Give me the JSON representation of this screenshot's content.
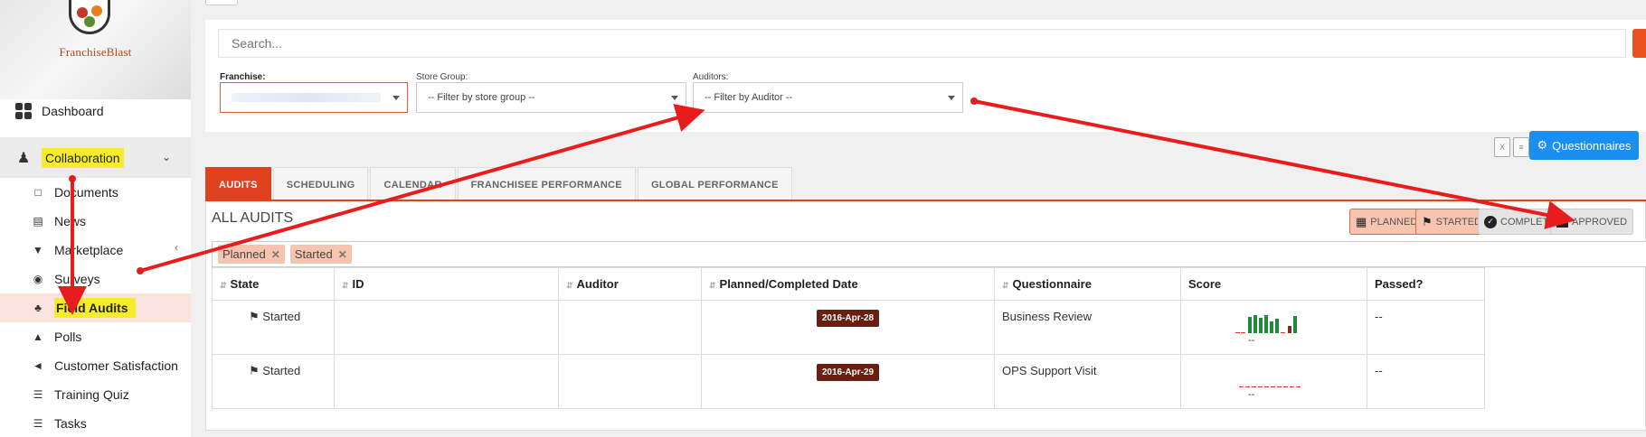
{
  "sidebar": {
    "logo_text": "FranchiseBlast",
    "dashboard_label": "Dashboard",
    "collaboration_label": "Collaboration",
    "items": [
      {
        "label": "Documents",
        "icon": "document-icon"
      },
      {
        "label": "News",
        "icon": "newspaper-icon"
      },
      {
        "label": "Marketplace",
        "icon": "cart-icon"
      },
      {
        "label": "Surveys",
        "icon": "target-icon"
      },
      {
        "label": "Field Audits",
        "icon": "trophy-icon"
      },
      {
        "label": "Polls",
        "icon": "bell-icon"
      },
      {
        "label": "Customer Satisfaction",
        "icon": "bullhorn-icon"
      },
      {
        "label": "Training Quiz",
        "icon": "list-icon"
      },
      {
        "label": "Tasks",
        "icon": "tasks-icon"
      }
    ]
  },
  "search": {
    "placeholder": "Search..."
  },
  "filters": {
    "franchise_label": "Franchise:",
    "store_group_label": "Store Group:",
    "store_group_value": "-- Filter by store group --",
    "auditors_label": "Auditors:",
    "auditors_value": "-- Filter by Auditor --"
  },
  "questionnaires_label": "Questionnaires",
  "tabs": [
    "AUDITS",
    "SCHEDULING",
    "CALENDAR",
    "FRANCHISEE PERFORMANCE",
    "GLOBAL PERFORMANCE"
  ],
  "panel_title": "ALL AUDITS",
  "status_filters": {
    "planned": "PLANNED",
    "started": "STARTED",
    "completed": "COMPLETED",
    "approved": "APPROVED"
  },
  "active_tags": [
    "Planned",
    "Started"
  ],
  "table": {
    "headers": [
      "State",
      "ID",
      "Auditor",
      "Planned/Completed Date",
      "Questionnaire",
      "Score",
      "Passed?"
    ],
    "rows": [
      {
        "state": "Started",
        "date": "2016-Apr-28",
        "questionnaire": "Business Review",
        "score": "--",
        "passed": "--"
      },
      {
        "state": "Started",
        "date": "2016-Apr-29",
        "questionnaire": "OPS Support Visit",
        "score": "--",
        "passed": "--"
      }
    ]
  },
  "colors": {
    "accent": "#e0411e",
    "highlight": "#f6ec2b",
    "primary_button": "#1a8ff0",
    "date_badge": "#6b1e10",
    "arrow": "#e81c1c"
  }
}
